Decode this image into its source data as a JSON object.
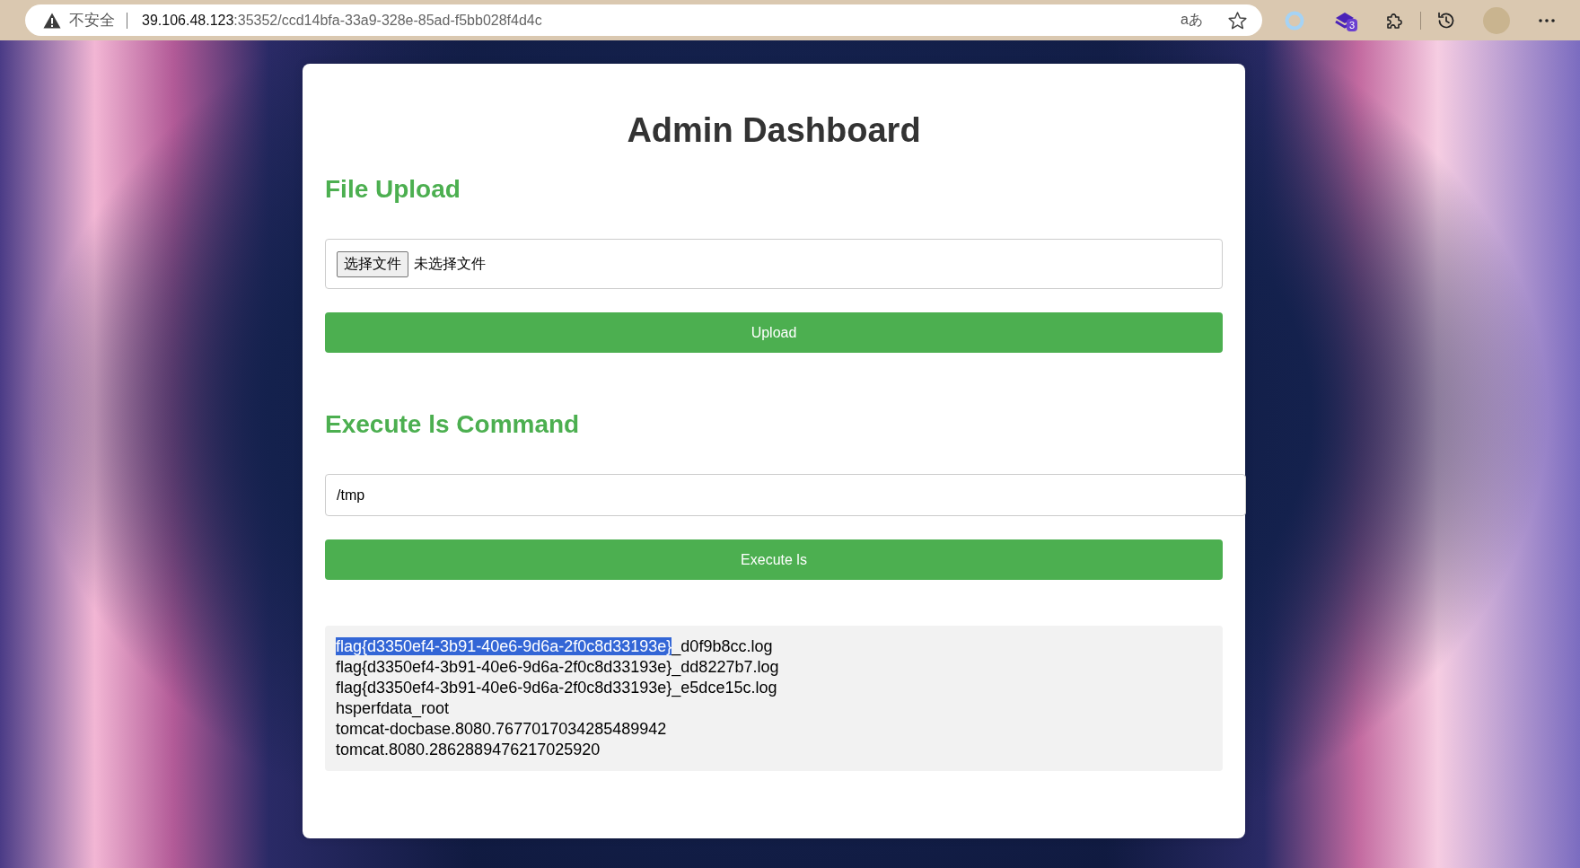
{
  "browser": {
    "security_label": "不安全",
    "url_host": "39.106.48.123",
    "url_path": ":35352/ccd14bfa-33a9-328e-85ad-f5bb028f4d4c",
    "reader_glyph": "aあ",
    "extension_badge": "3"
  },
  "page": {
    "title": "Admin Dashboard",
    "sections": [
      {
        "kind": "file",
        "heading": "File Upload",
        "choose_button": "选择文件",
        "file_status": "未选择文件",
        "button": "Upload"
      },
      {
        "kind": "command",
        "heading": "Execute ls Command",
        "input_value": "/tmp",
        "button": "Execute ls"
      }
    ],
    "output": {
      "lines": [
        {
          "parts": [
            {
              "text": "flag{d3350ef4-3b91-40e6-9d6a-2f0c8d33193e}",
              "selected": true
            },
            {
              "text": "_d0f9b8cc.log",
              "selected": false
            }
          ]
        },
        {
          "parts": [
            {
              "text": "flag{d3350ef4-3b91-40e6-9d6a-2f0c8d33193e}_dd8227b7.log",
              "selected": false
            }
          ]
        },
        {
          "parts": [
            {
              "text": "flag{d3350ef4-3b91-40e6-9d6a-2f0c8d33193e}_e5dce15c.log",
              "selected": false
            }
          ]
        },
        {
          "parts": [
            {
              "text": "hsperfdata_root",
              "selected": false
            }
          ]
        },
        {
          "parts": [
            {
              "text": "tomcat-docbase.8080.7677017034285489942",
              "selected": false
            }
          ]
        },
        {
          "parts": [
            {
              "text": "tomcat.8080.2862889476217025920",
              "selected": false
            }
          ]
        }
      ]
    }
  }
}
